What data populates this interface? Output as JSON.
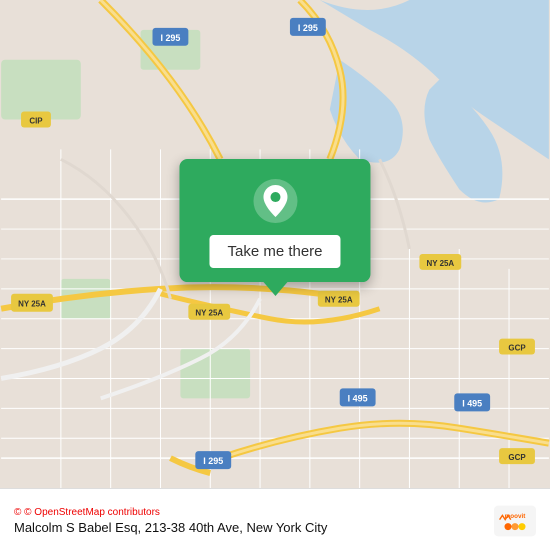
{
  "map": {
    "alt": "Map of Malcolm S Babel Esq location",
    "bg_color": "#e8e0d8",
    "water_color": "#b8d4e8",
    "road_color": "#ffffff",
    "highway_color": "#f5c842",
    "highway_label_color": "#7a5c00",
    "green_color": "#c8dfc0"
  },
  "popup": {
    "bg_color": "#2eaa5e",
    "button_label": "Take me there",
    "icon_name": "location-pin-icon"
  },
  "bottom_bar": {
    "osm_credit": "© OpenStreetMap contributors",
    "address": "Malcolm S Babel Esq, 213-38 40th Ave, New York City",
    "logo_name": "moovit-logo"
  }
}
